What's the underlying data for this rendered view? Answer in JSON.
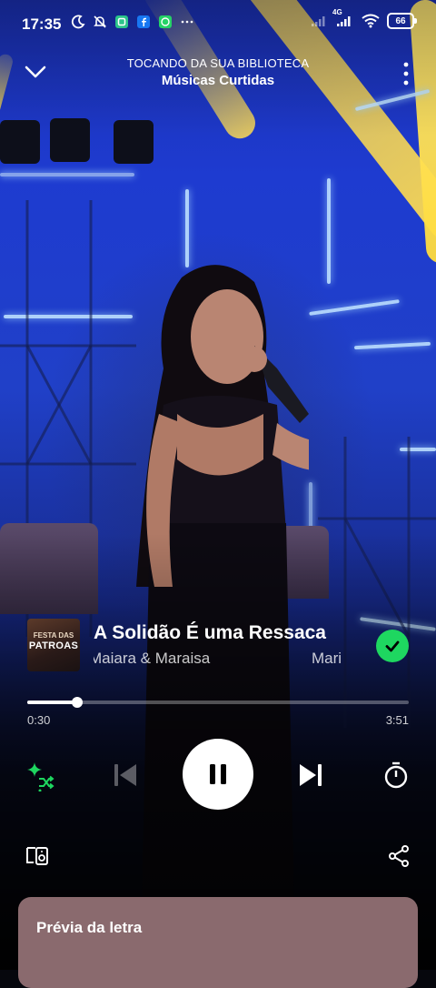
{
  "status_bar": {
    "time": "17:35",
    "network": "4G",
    "battery": "66"
  },
  "header": {
    "context_label": "TOCANDO DA SUA BIBLIOTECA",
    "playlist_name": "Músicas Curtidas"
  },
  "album_cover": {
    "line1": "FESTA DAS",
    "line2": "PATROAS"
  },
  "track": {
    "title": "A Solidão É uma Ressaca",
    "artist": "Maiara & Maraisa",
    "artist_repeat": "Mari"
  },
  "playback": {
    "current_time": "0:30",
    "total_time": "3:51",
    "progress_fraction": 0.13
  },
  "lyrics_card": {
    "title": "Prévia da letra"
  },
  "colors": {
    "accent": "#1ed760",
    "lyrics_card": "#8a6a6e"
  }
}
